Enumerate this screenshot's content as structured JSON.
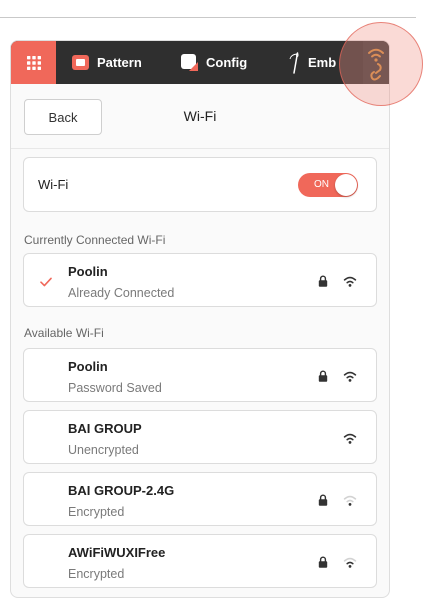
{
  "colors": {
    "accent": "#f0685a",
    "nav_background": "#2f2f2f",
    "wifi_link_icon": "#d08a3c"
  },
  "nav": {
    "menu_icon": "grid-menu-icon",
    "tabs": [
      {
        "label": "Pattern",
        "icon": "pattern-icon"
      },
      {
        "label": "Config",
        "icon": "config-icon"
      },
      {
        "label": "Emb",
        "icon": "needle-icon"
      }
    ],
    "wifi_button_icon": "wifi-link-icon"
  },
  "header": {
    "back_label": "Back",
    "title": "Wi-Fi"
  },
  "wifi_toggle": {
    "label": "Wi-Fi",
    "state_label": "ON",
    "on": true
  },
  "signal_max": 3,
  "connected": {
    "section_label": "Currently Connected Wi-Fi",
    "network": {
      "name": "Poolin",
      "status": "Already Connected",
      "locked": true,
      "signal": 3,
      "selected": true
    }
  },
  "available": {
    "section_label": "Available Wi-Fi",
    "networks": [
      {
        "name": "Poolin",
        "status": "Password Saved",
        "locked": true,
        "signal": 3
      },
      {
        "name": "BAI GROUP",
        "status": "Unencrypted",
        "locked": false,
        "signal": 3
      },
      {
        "name": "BAI GROUP-2.4G",
        "status": "Encrypted",
        "locked": true,
        "signal": 1
      },
      {
        "name": "AWiFiWUXIFree",
        "status": "Encrypted",
        "locked": true,
        "signal": 2
      }
    ]
  }
}
